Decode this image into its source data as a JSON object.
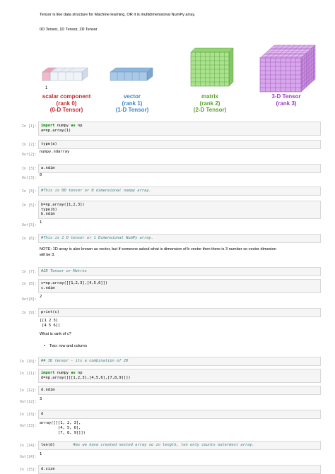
{
  "intro": {
    "line1": "Tensor is like data structure for Machine learning. OR it is multidimensional NumPy array.",
    "line2": "0D Tensor, 1D Tensor, 2D Tensor"
  },
  "figure": {
    "scalar_marker": "1",
    "labels": [
      {
        "l1": "scalar component",
        "l2": "(rank 0)",
        "l3": "(0-D Tensor)",
        "color": "#c0292e"
      },
      {
        "l1": "vector",
        "l2": "(rank 1)",
        "l3": "(1-D Tensor)",
        "color": "#3d86c5"
      },
      {
        "l1": "matrix",
        "l2": "(rank 2)",
        "l3": "(2-D Tensor)",
        "color": "#5aa02c"
      },
      {
        "l1": "3-D Tensor",
        "l2": "(rank 3)",
        "l3": "",
        "color": "#9b3dbf"
      }
    ],
    "colors": {
      "scalar_red": "#f5b8c8",
      "vector_blue": "#a9c9e6",
      "matrix_green": "#a9e38d",
      "tensor_purple": "#d8a6ec"
    }
  },
  "cells": {
    "c1": {
      "prompt": "In [1]:",
      "code1": "import",
      "code1b": " numpy ",
      "code1c": "as",
      "code1d": " np",
      "code2": "a=np.array(1)"
    },
    "c2": {
      "prompt": "In [2]:",
      "code": "type(a)",
      "out_prompt": "Out[2]:",
      "out": "numpy.ndarray"
    },
    "c3": {
      "prompt": "In [3]:",
      "code": "a.ndim",
      "out_prompt": "Out[3]:",
      "out": "0"
    },
    "c4": {
      "prompt": "In [4]:",
      "code": "#This is 0D tensor or 0 dimensional numpy array."
    },
    "c5": {
      "prompt": "In [5]:",
      "code1": "b=np.array([1,2,3])",
      "code2": "type(b)",
      "code3": "b.ndim",
      "out_prompt": "Out[5]:",
      "out": "1"
    },
    "c6": {
      "prompt": "In [6]:",
      "code": "#This is 1 D tensor or 1 Dimensional NumPy array."
    },
    "note": {
      "line1": "NOTE: 1D array is also known as vector, but if someone asked what is dimension of b vector then there is 3 number so vector dimesion",
      "line2": "will be 3."
    },
    "c7": {
      "prompt": "In [7]:",
      "code": "#2D Tensor or Matrix"
    },
    "c8": {
      "prompt": "In [8]:",
      "code1": "c=np.array([[1,2,3],[4,5,6]])",
      "code2": "c.ndim",
      "out_prompt": "Out[8]:",
      "out": "2"
    },
    "c9": {
      "prompt": "In [9]:",
      "code": "print(c)",
      "out1": "[[1 2 3]",
      "out2": " [4 5 6]]"
    },
    "q": {
      "text": "What is rank of c?",
      "bullet": "Two: row and column"
    },
    "c10": {
      "prompt": "In [10]:",
      "code": "## 3D tensor - its a combination of 2D"
    },
    "c11": {
      "prompt": "In [11]:",
      "code1a": "import",
      "code1b": " numpy ",
      "code1c": "as",
      "code1d": " np",
      "code2": "d=np.array([[[1,2,3],[4,5,6],[7,8,9]]])"
    },
    "c12": {
      "prompt": "In [12]:",
      "code": "d.ndim",
      "out_prompt": "Out[12]:",
      "out": "3"
    },
    "c13": {
      "prompt": "In [13]:",
      "code": "d",
      "out_prompt": "Out[13]:",
      "out1": "array([[[1, 2, 3],",
      "out2": "        [4, 5, 6],",
      "out3": "        [7, 8, 9]]])"
    },
    "c14": {
      "prompt": "In [14]:",
      "code": "len(d)",
      "comment": "#as we have created nested array so in length, len only counts outermost array.",
      "out_prompt": "Out[14]:",
      "out": "1"
    },
    "c15": {
      "prompt": "In [15]:",
      "code": "d.size"
    }
  }
}
